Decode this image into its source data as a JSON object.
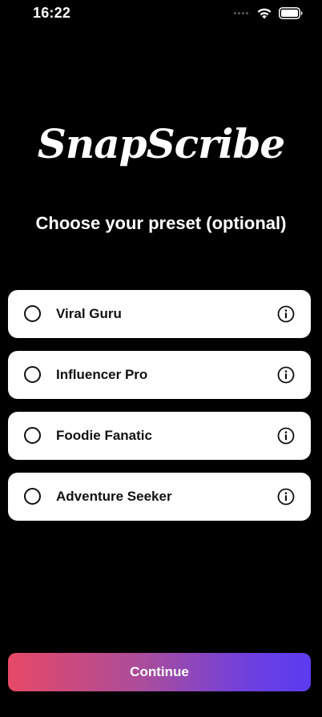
{
  "status_bar": {
    "time": "16:22",
    "icons": [
      "signal-dots-icon",
      "wifi-icon",
      "battery-icon"
    ]
  },
  "app": {
    "logo_text": "SnapScribe"
  },
  "main": {
    "title": "Choose your preset (optional)",
    "presets": [
      {
        "label": "Viral Guru",
        "selected": false,
        "icon": "info-icon"
      },
      {
        "label": "Influencer Pro",
        "selected": false,
        "icon": "info-icon"
      },
      {
        "label": "Foodie Fanatic",
        "selected": false,
        "icon": "info-icon"
      },
      {
        "label": "Adventure Seeker",
        "selected": false,
        "icon": "info-icon"
      }
    ]
  },
  "footer": {
    "continue_label": "Continue"
  },
  "colors": {
    "background": "#000000",
    "card": "#ffffff",
    "gradient_start": "#e64966",
    "gradient_end": "#5a3cf0"
  }
}
